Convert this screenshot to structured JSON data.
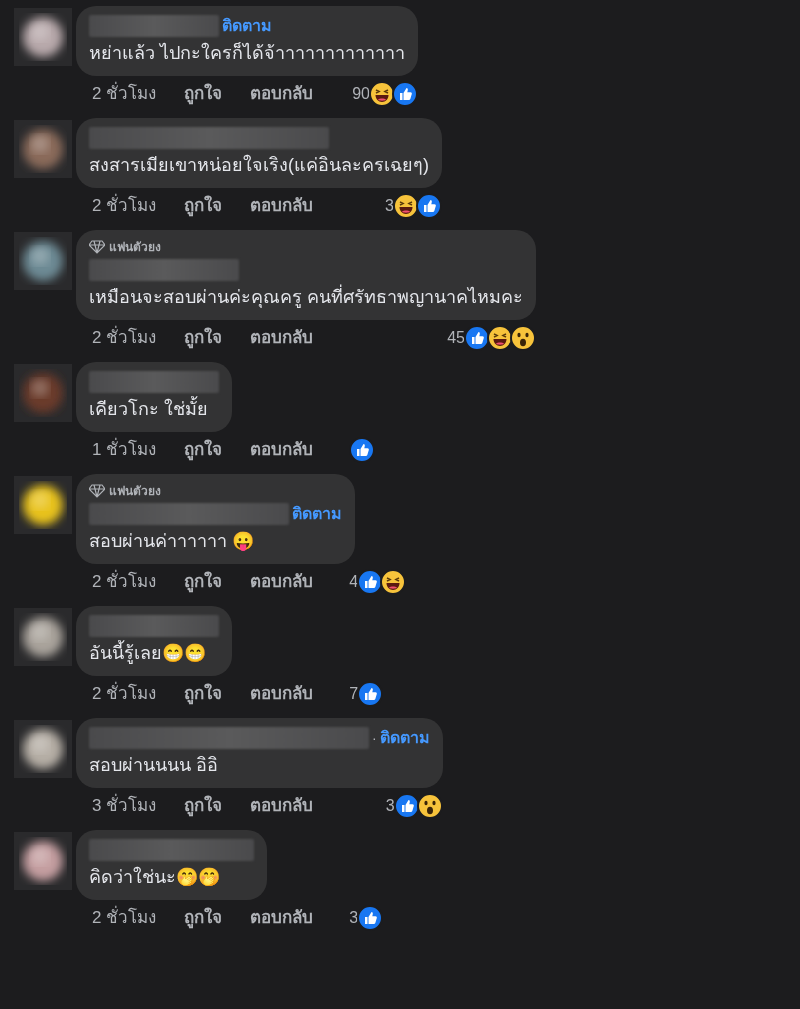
{
  "comments": [
    {
      "follow": "ติดตาม",
      "text": "หย่าแล้ว ไปกะใครก็ได้จ้าาาาาาาาาาาาา",
      "time": "2 ชั่วโมง",
      "like": "ถูกใจ",
      "reply": "ตอบกลับ",
      "reaction_count": "90",
      "reactions": [
        {
          "kind": "haha"
        },
        {
          "kind": "like"
        }
      ]
    },
    {
      "text": "สงสารเมียเขาหน่อยใจเริง(แค่อินละครเฉยๆ)",
      "time": "2 ชั่วโมง",
      "like": "ถูกใจ",
      "reply": "ตอบกลับ",
      "reaction_count": "3",
      "reactions": [
        {
          "kind": "haha"
        },
        {
          "kind": "like"
        }
      ]
    },
    {
      "badge": "แฟนตัวยง",
      "text": "เหมือนจะสอบผ่านค่ะคุณครู คนที่ศรัทธาพญานาคไหมคะ",
      "time": "2 ชั่วโมง",
      "like": "ถูกใจ",
      "reply": "ตอบกลับ",
      "reaction_count": "45",
      "reactions": [
        {
          "kind": "like"
        },
        {
          "kind": "haha"
        },
        {
          "kind": "wow"
        }
      ]
    },
    {
      "text": "เคียวโกะ ใช่มั้ย",
      "time": "1 ชั่วโมง",
      "like": "ถูกใจ",
      "reply": "ตอบกลับ",
      "reactions": [
        {
          "kind": "like"
        }
      ]
    },
    {
      "badge": "แฟนตัวยง",
      "follow": "ติดตาม",
      "text": "สอบผ่านค่าาาาาา 😛",
      "time": "2 ชั่วโมง",
      "like": "ถูกใจ",
      "reply": "ตอบกลับ",
      "reaction_count": "4",
      "reactions": [
        {
          "kind": "like"
        },
        {
          "kind": "haha"
        }
      ]
    },
    {
      "text": "อันนี้รู้เลย😁😁",
      "time": "2 ชั่วโมง",
      "like": "ถูกใจ",
      "reply": "ตอบกลับ",
      "reaction_count": "7",
      "reactions": [
        {
          "kind": "like"
        }
      ]
    },
    {
      "separator": "·",
      "follow": "ติดตาม",
      "text": "สอบผ่านนนน อิอิ",
      "time": "3 ชั่วโมง",
      "like": "ถูกใจ",
      "reply": "ตอบกลับ",
      "reaction_count": "3",
      "reactions": [
        {
          "kind": "like"
        },
        {
          "kind": "wow"
        }
      ]
    },
    {
      "text": "คิดว่าใช่นะ🤭🤭",
      "time": "2 ชั่วโมง",
      "like": "ถูกใจ",
      "reply": "ตอบกลับ",
      "reaction_count": "3",
      "reactions": [
        {
          "kind": "like"
        }
      ]
    }
  ]
}
